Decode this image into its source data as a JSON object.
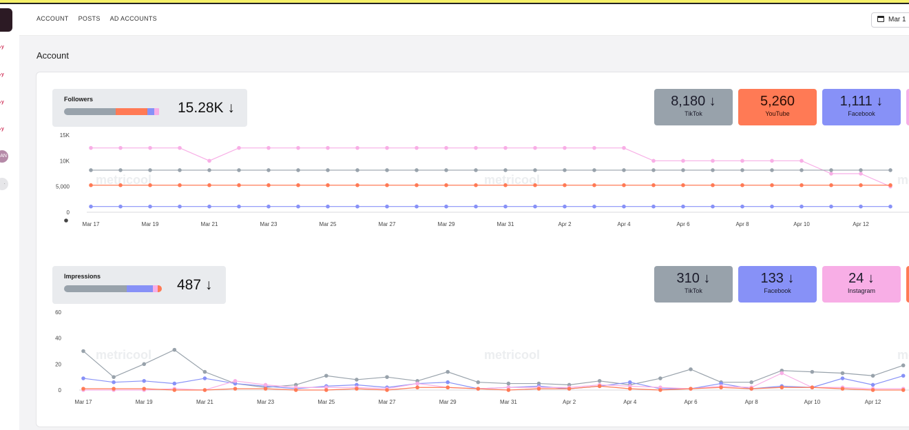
{
  "nav": {
    "items": [
      "ACCOUNT",
      "POSTS",
      "AD ACCOUNTS"
    ],
    "date": "Mar 1"
  },
  "section_title": "Account",
  "watermark": "metricool",
  "sidebar": {
    "avatar_initials": "AN"
  },
  "colors": {
    "tiktok": "#98a2ab",
    "youtube": "#ff7a55",
    "facebook": "#8791f7",
    "instagram": "#f8aee6"
  },
  "followers": {
    "label": "Followers",
    "total": "15.28K",
    "share": [
      0.53,
      0.32,
      0.07,
      0.05
    ],
    "networks": [
      {
        "value": "8,180",
        "name": "TikTok",
        "color": "#98a2ab"
      },
      {
        "value": "5,260",
        "name": "YouTube",
        "color": "#ff7a55"
      },
      {
        "value": "1,111",
        "name": "Facebook",
        "color": "#8791f7"
      }
    ]
  },
  "impressions": {
    "label": "Impressions",
    "total": "487",
    "share": [
      0.64,
      0.27,
      0.05,
      0.04
    ],
    "networks": [
      {
        "value": "310",
        "name": "TikTok",
        "color": "#98a2ab"
      },
      {
        "value": "133",
        "name": "Facebook",
        "color": "#8791f7"
      },
      {
        "value": "24",
        "name": "Instagram",
        "color": "#f8aee6"
      }
    ]
  },
  "chart_data": [
    {
      "type": "line",
      "title": "Followers",
      "x": [
        "Mar 17",
        "Mar 18",
        "Mar 19",
        "Mar 20",
        "Mar 21",
        "Mar 22",
        "Mar 23",
        "Mar 24",
        "Mar 25",
        "Mar 26",
        "Mar 27",
        "Mar 28",
        "Mar 29",
        "Mar 30",
        "Mar 31",
        "Apr 1",
        "Apr 2",
        "Apr 3",
        "Apr 4",
        "Apr 5",
        "Apr 6",
        "Apr 7",
        "Apr 8",
        "Apr 9",
        "Apr 10",
        "Apr 11",
        "Apr 12",
        "Apr 13"
      ],
      "tick_labels": [
        "Mar 17",
        "Mar 19",
        "Mar 21",
        "Mar 23",
        "Mar 25",
        "Mar 27",
        "Mar 29",
        "Mar 31",
        "Apr 2",
        "Apr 4",
        "Apr 6",
        "Apr 8",
        "Apr 10",
        "Apr 12"
      ],
      "y_ticks": [
        "0",
        "5,000",
        "10K",
        "15K"
      ],
      "ylim": [
        0,
        15000
      ],
      "grid": false,
      "series": [
        {
          "color": "#f8aee6",
          "values": [
            12500,
            12500,
            12500,
            12500,
            10000,
            12500,
            12500,
            12500,
            12500,
            12500,
            12500,
            12500,
            12500,
            12500,
            12500,
            12500,
            12500,
            12500,
            12500,
            10000,
            10000,
            10000,
            10000,
            10000,
            10000,
            7500,
            7500,
            5000
          ]
        },
        {
          "color": "#98a2ab",
          "values": [
            8180,
            8180,
            8180,
            8180,
            8180,
            8180,
            8180,
            8180,
            8180,
            8180,
            8180,
            8180,
            8180,
            8180,
            8180,
            8180,
            8180,
            8180,
            8180,
            8180,
            8180,
            8180,
            8180,
            8180,
            8180,
            8180,
            8180,
            8180
          ]
        },
        {
          "color": "#ff7a55",
          "values": [
            5260,
            5260,
            5260,
            5260,
            5260,
            5260,
            5260,
            5260,
            5260,
            5260,
            5260,
            5260,
            5260,
            5260,
            5260,
            5260,
            5260,
            5260,
            5260,
            5260,
            5260,
            5260,
            5260,
            5260,
            5260,
            5260,
            5260,
            5260
          ]
        },
        {
          "color": "#8791f7",
          "values": [
            1111,
            1111,
            1111,
            1111,
            1111,
            1111,
            1111,
            1111,
            1111,
            1111,
            1111,
            1111,
            1111,
            1111,
            1111,
            1111,
            1111,
            1111,
            1111,
            1111,
            1111,
            1111,
            1111,
            1111,
            1111,
            1111,
            1111,
            1111
          ]
        }
      ]
    },
    {
      "type": "line",
      "title": "Impressions",
      "x": [
        "Mar 17",
        "Mar 18",
        "Mar 19",
        "Mar 20",
        "Mar 21",
        "Mar 22",
        "Mar 23",
        "Mar 24",
        "Mar 25",
        "Mar 26",
        "Mar 27",
        "Mar 28",
        "Mar 29",
        "Mar 30",
        "Mar 31",
        "Apr 1",
        "Apr 2",
        "Apr 3",
        "Apr 4",
        "Apr 5",
        "Apr 6",
        "Apr 7",
        "Apr 8",
        "Apr 9",
        "Apr 10",
        "Apr 11",
        "Apr 12",
        "Apr 13"
      ],
      "tick_labels": [
        "Mar 17",
        "Mar 19",
        "Mar 21",
        "Mar 23",
        "Mar 25",
        "Mar 27",
        "Mar 29",
        "Mar 31",
        "Apr 2",
        "Apr 4",
        "Apr 6",
        "Apr 8",
        "Apr 10",
        "Apr 12"
      ],
      "y_ticks": [
        "0",
        "20",
        "40",
        "60"
      ],
      "ylim": [
        0,
        60
      ],
      "grid": false,
      "series": [
        {
          "color": "#98a2ab",
          "values": [
            30,
            10,
            20,
            31,
            14,
            5,
            2,
            4,
            11,
            8,
            10,
            7,
            14,
            6,
            5,
            5,
            4,
            7,
            4,
            9,
            16,
            6,
            6,
            15,
            14,
            13,
            11,
            19
          ]
        },
        {
          "color": "#8791f7",
          "values": [
            9,
            6,
            7,
            5,
            9,
            5,
            3,
            1,
            3,
            4,
            2,
            5,
            6,
            1,
            2,
            3,
            1,
            3,
            6,
            1,
            1,
            5,
            1,
            3,
            2,
            9,
            4,
            11
          ]
        },
        {
          "color": "#f8aee6",
          "values": [
            0,
            0,
            0,
            1,
            0,
            7,
            4,
            2,
            2,
            2,
            1,
            5,
            2,
            1,
            2,
            2,
            2,
            4,
            3,
            2,
            1,
            3,
            2,
            13,
            2,
            2,
            1,
            1
          ]
        },
        {
          "color": "#ff7a55",
          "values": [
            1,
            1,
            1,
            0,
            0,
            1,
            1,
            0,
            0,
            1,
            0,
            2,
            2,
            1,
            0,
            1,
            1,
            3,
            1,
            0,
            1,
            2,
            1,
            2,
            2,
            1,
            0,
            0
          ]
        }
      ]
    }
  ]
}
